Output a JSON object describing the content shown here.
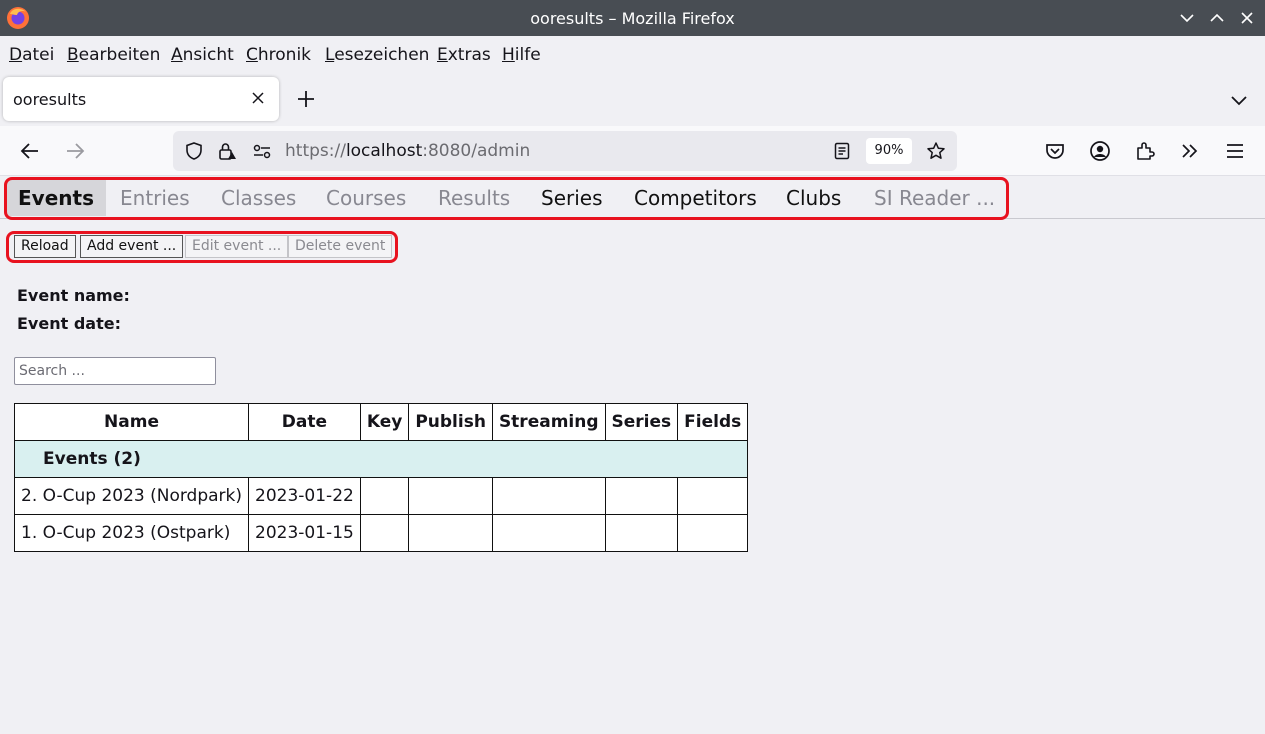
{
  "window": {
    "title": "ooresults – Mozilla Firefox"
  },
  "menu": [
    {
      "accel": "D",
      "rest": "atei"
    },
    {
      "accel": "B",
      "rest": "earbeiten"
    },
    {
      "accel": "A",
      "rest": "nsicht"
    },
    {
      "accel": "C",
      "rest": "hronik"
    },
    {
      "accel": "L",
      "rest": "esezeichen"
    },
    {
      "accel": "E",
      "rest": "xtras"
    },
    {
      "accel": "H",
      "rest": "ilfe"
    }
  ],
  "browser_tab": {
    "label": "ooresults"
  },
  "urlbar": {
    "scheme": "https://",
    "host": "localhost",
    "rest": ":8080/admin",
    "zoom": "90%"
  },
  "app_tabs": [
    {
      "label": "Events",
      "state": "active"
    },
    {
      "label": "Entries",
      "state": "disabled"
    },
    {
      "label": "Classes",
      "state": "disabled"
    },
    {
      "label": "Courses",
      "state": "disabled"
    },
    {
      "label": "Results",
      "state": "disabled"
    },
    {
      "label": "Series",
      "state": "enabled"
    },
    {
      "label": "Competitors",
      "state": "enabled"
    },
    {
      "label": "Clubs",
      "state": "enabled"
    },
    {
      "label": "SI Reader ...",
      "state": "disabled"
    }
  ],
  "toolbar": {
    "reload": "Reload",
    "add": "Add event ...",
    "edit": "Edit event ...",
    "delete": "Delete event"
  },
  "info": {
    "event_name_label": "Event name:",
    "event_date_label": "Event date:"
  },
  "search": {
    "placeholder": "Search ..."
  },
  "table": {
    "headers": {
      "name": "Name",
      "date": "Date",
      "key": "Key",
      "publish": "Publish",
      "streaming": "Streaming",
      "series": "Series",
      "fields": "Fields"
    },
    "group": "Events  (2)",
    "rows": [
      {
        "name": "2. O-Cup 2023 (Nordpark)",
        "date": "2023-01-22",
        "key": "",
        "publish": "",
        "streaming": "",
        "series": "",
        "fields": ""
      },
      {
        "name": "1. O-Cup 2023 (Ostpark)",
        "date": "2023-01-15",
        "key": "",
        "publish": "",
        "streaming": "",
        "series": "",
        "fields": ""
      }
    ]
  },
  "colors": {
    "highlight": "#e8121f",
    "group_row": "#d9f0f0",
    "titlebar": "#484d53"
  }
}
